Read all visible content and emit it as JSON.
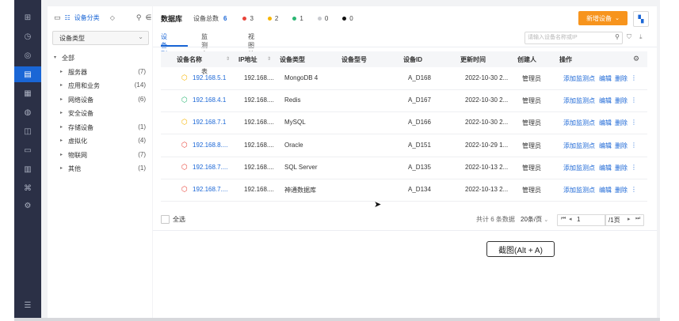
{
  "rail": {
    "icons": [
      "grid-icon",
      "clock-icon",
      "bell-icon",
      "document-icon",
      "list-icon",
      "globe-icon",
      "folder-icon",
      "monitor-icon",
      "bar-chart-icon",
      "network-icon",
      "gear-icon",
      "menu-icon"
    ],
    "glyphs": [
      "⊞",
      "◷",
      "◎",
      "▤",
      "▦",
      "◍",
      "◫",
      "▭",
      "▥",
      "⌘",
      "⚙",
      "☰"
    ]
  },
  "sidebar": {
    "title": "设备分类",
    "select_value": "设备类型",
    "tree": [
      {
        "label": "全部",
        "count": "",
        "level": 0,
        "expanded": true
      },
      {
        "label": "服务器",
        "count": "(7)",
        "level": 1
      },
      {
        "label": "应用和业务",
        "count": "(14)",
        "level": 1
      },
      {
        "label": "网络设备",
        "count": "(6)",
        "level": 1
      },
      {
        "label": "安全设备",
        "count": "",
        "level": 1
      },
      {
        "label": "存储设备",
        "count": "(1)",
        "level": 1
      },
      {
        "label": "虚拟化",
        "count": "(4)",
        "level": 1
      },
      {
        "label": "物联网",
        "count": "(7)",
        "level": 1
      },
      {
        "label": "其他",
        "count": "(1)",
        "level": 1
      }
    ]
  },
  "header": {
    "title": "数据库",
    "total_label": "设备总数",
    "total_value": "6",
    "status": [
      {
        "color": "#e8443a",
        "value": "3",
        "shape": "dot"
      },
      {
        "color": "#f7b500",
        "value": "2",
        "shape": "dot"
      },
      {
        "color": "#2bb673",
        "value": "1",
        "shape": "dot"
      },
      {
        "color": "#c9cbd0",
        "value": "0",
        "shape": "dot"
      },
      {
        "color": "#111111",
        "value": "0",
        "shape": "dot"
      }
    ],
    "new_button": "新增设备"
  },
  "tabs": [
    "设备列表",
    "监测点列表",
    "视图统计"
  ],
  "search": {
    "placeholder": "请输入设备名称或IP"
  },
  "table": {
    "columns": [
      "设备名称",
      "IP地址",
      "设备类型",
      "设备型号",
      "设备ID",
      "更新时间",
      "创建人",
      "操作"
    ],
    "rows": [
      {
        "status_color": "#f7b500",
        "name": "192.168.5.1",
        "ip": "192.168....",
        "type": "MongoDB 4",
        "model": "",
        "id": "A_D168",
        "time": "2022-10-30 2...",
        "creator": "管理员"
      },
      {
        "status_color": "#2bb673",
        "name": "192.168.4.1",
        "ip": "192.168....",
        "type": "Redis",
        "model": "",
        "id": "A_D167",
        "time": "2022-10-30 2...",
        "creator": "管理员"
      },
      {
        "status_color": "#f7b500",
        "name": "192.168.7.1",
        "ip": "192.168....",
        "type": "MySQL",
        "model": "",
        "id": "A_D166",
        "time": "2022-10-30 2...",
        "creator": "管理员"
      },
      {
        "status_color": "#e8443a",
        "name": "192.168.8....",
        "ip": "192.168....",
        "type": "Oracle",
        "model": "",
        "id": "A_D151",
        "time": "2022-10-29 1...",
        "creator": "管理员"
      },
      {
        "status_color": "#e8443a",
        "name": "192.168.7....",
        "ip": "192.168....",
        "type": "SQL Server",
        "model": "",
        "id": "A_D135",
        "time": "2022-10-13 2...",
        "creator": "管理员"
      },
      {
        "status_color": "#e8443a",
        "name": "192.168.7....",
        "ip": "192.168....",
        "type": "神通数据库",
        "model": "",
        "id": "A_D134",
        "time": "2022-10-13 2...",
        "creator": "管理员"
      }
    ],
    "actions": [
      "添加监测点",
      "编辑",
      "删除",
      "⋮"
    ]
  },
  "footer": {
    "select_all": "全选",
    "total_text": "共计 6 条数据",
    "page_size": "20条/页",
    "current_page": "1",
    "total_pages": "/1页"
  },
  "tooltip": "截图(Alt + A)"
}
